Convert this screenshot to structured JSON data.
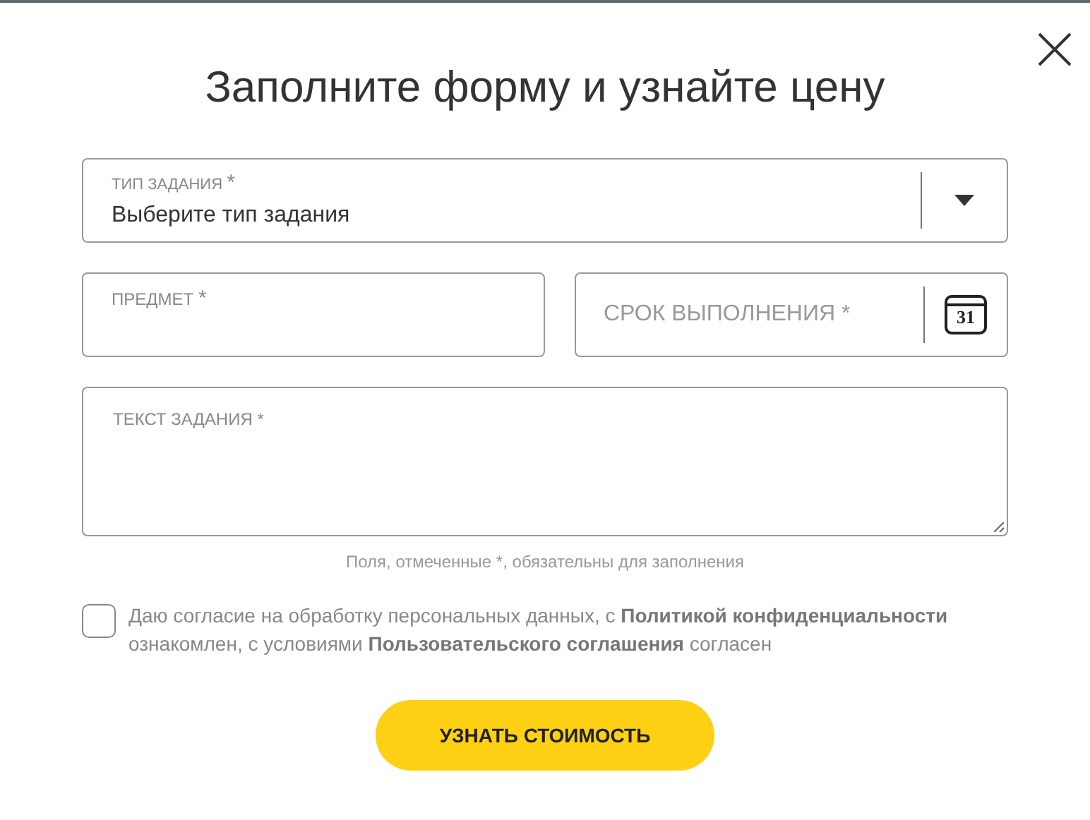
{
  "title": "Заполните форму и узнайте цену",
  "task_type": {
    "label": "ТИП ЗАДАНИЯ",
    "required_mark": "*",
    "value": "Выберите тип задания"
  },
  "subject": {
    "label": "ПРЕДМЕТ",
    "required_mark": "*"
  },
  "deadline": {
    "placeholder": "СРОК ВЫПОЛНЕНИЯ *",
    "calendar_day": "31"
  },
  "task_text": {
    "label": "ТЕКСТ ЗАДАНИЯ *"
  },
  "required_note": "Поля, отмеченные *, обязательны для заполнения",
  "consent": {
    "checked": false,
    "parts": [
      {
        "kind": "text",
        "text": "Даю согласие на обработку персональных данных, с "
      },
      {
        "kind": "link",
        "text": "Политикой конфиденциальности"
      },
      {
        "kind": "text",
        "text": " ознакомлен, с условиями "
      },
      {
        "kind": "link",
        "text": "Пользовательского соглашения"
      },
      {
        "kind": "text",
        "text": " согласен"
      }
    ]
  },
  "submit": "УЗНАТЬ СТОИМОСТЬ"
}
